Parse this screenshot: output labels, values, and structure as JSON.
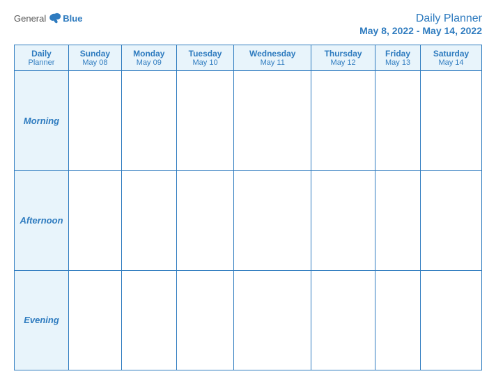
{
  "logo": {
    "general": "General",
    "blue": "Blue"
  },
  "title": {
    "main": "Daily Planner",
    "date_range": "May 8, 2022 - May 14, 2022"
  },
  "header_row": {
    "corner_label_line1": "Daily",
    "corner_label_line2": "Planner",
    "days": [
      {
        "name": "Sunday",
        "date": "May 08"
      },
      {
        "name": "Monday",
        "date": "May 09"
      },
      {
        "name": "Tuesday",
        "date": "May 10"
      },
      {
        "name": "Wednesday",
        "date": "May 11"
      },
      {
        "name": "Thursday",
        "date": "May 12"
      },
      {
        "name": "Friday",
        "date": "May 13"
      },
      {
        "name": "Saturday",
        "date": "May 14"
      }
    ]
  },
  "rows": [
    {
      "label": "Morning"
    },
    {
      "label": "Afternoon"
    },
    {
      "label": "Evening"
    }
  ]
}
